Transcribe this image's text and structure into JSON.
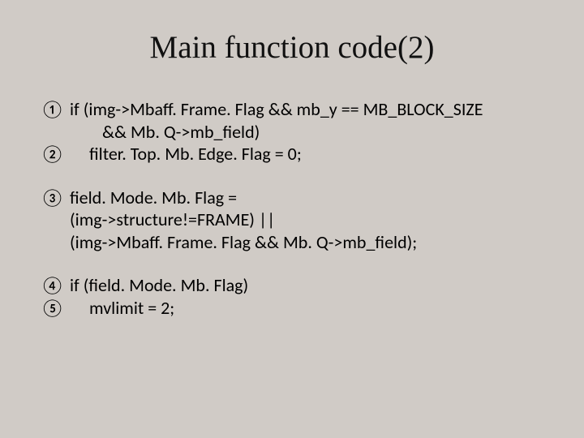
{
  "title": "Main function code(2)",
  "lines": {
    "n1": "①",
    "n2": "②",
    "n3": "③",
    "n4": "④",
    "n5": "⑤",
    "l1a": "if (img->Mbaff. Frame. Flag && mb_y == MB_BLOCK_SIZE",
    "l1b": "&& Mb. Q->mb_field)",
    "l2": "filter. Top. Mb. Edge. Flag = 0;",
    "l3a": "field. Mode. Mb. Flag =",
    "l3b": "(img->structure!=FRAME) ||",
    "l3c": "(img->Mbaff. Frame. Flag && Mb. Q->mb_field);",
    "l4": "if (field. Mode. Mb. Flag)",
    "l5": "mvlimit = 2;"
  }
}
